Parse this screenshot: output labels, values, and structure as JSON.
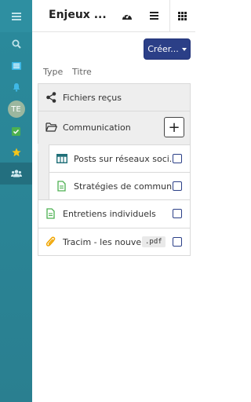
{
  "sidebar": {
    "items": [
      {
        "icon": "menu-icon"
      },
      {
        "icon": "search-icon"
      },
      {
        "icon": "dashboard-list-icon"
      },
      {
        "icon": "bell-icon"
      },
      {
        "icon": "avatar",
        "initials": "TE"
      },
      {
        "icon": "check-square-icon"
      },
      {
        "icon": "star-icon"
      },
      {
        "icon": "users-icon"
      }
    ]
  },
  "header": {
    "title": "Enjeux ...",
    "icons": [
      "gauge-icon",
      "list-icon",
      "grid-icon"
    ]
  },
  "toolbar": {
    "create_label": "Créer..."
  },
  "columns": {
    "type": "Type",
    "title": "Titre"
  },
  "rows": [
    {
      "label": "Fichiers reçus",
      "icon": "share-icon"
    },
    {
      "label": "Communication",
      "icon": "folder-open-icon",
      "action": "+"
    },
    {
      "label": "Posts sur réseaux soci...",
      "icon": "kanban-icon"
    },
    {
      "label": "Stratégies de communi...",
      "icon": "document-icon"
    },
    {
      "label": "Entretiens individuels",
      "icon": "document-icon"
    },
    {
      "label": "Tracim - les nouve...",
      "icon": "paperclip-icon",
      "badge": ".pdf"
    }
  ],
  "colors": {
    "sidebar": "#2a8a9c",
    "primary": "#2b3f87",
    "green": "#2a9d3a",
    "orange": "#f0a500"
  }
}
